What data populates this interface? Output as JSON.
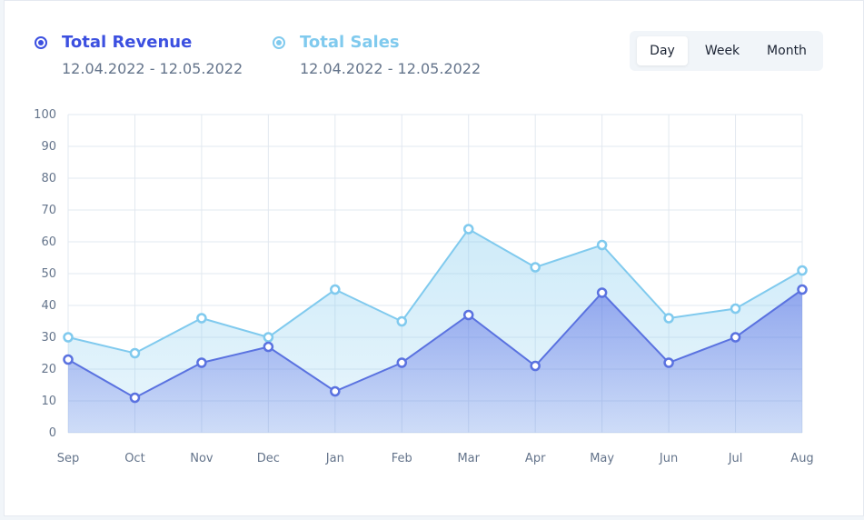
{
  "legend": {
    "revenue": {
      "title": "Total Revenue",
      "range": "12.04.2022 - 12.05.2022"
    },
    "sales": {
      "title": "Total Sales",
      "range": "12.04.2022 - 12.05.2022"
    }
  },
  "period_switcher": {
    "options": [
      "Day",
      "Week",
      "Month"
    ],
    "selected": "Day"
  },
  "colors": {
    "revenue": "#3c50e0",
    "revenue_line": "#5a72e0",
    "sales": "#80caee",
    "grid": "#e2e8f0",
    "text": "#64748b"
  },
  "chart_data": {
    "type": "area",
    "categories": [
      "Sep",
      "Oct",
      "Nov",
      "Dec",
      "Jan",
      "Feb",
      "Mar",
      "Apr",
      "May",
      "Jun",
      "Jul",
      "Aug"
    ],
    "series": [
      {
        "name": "Total Revenue",
        "values": [
          23,
          11,
          22,
          27,
          13,
          22,
          37,
          21,
          44,
          22,
          30,
          45
        ]
      },
      {
        "name": "Total Sales",
        "values": [
          30,
          25,
          36,
          30,
          45,
          35,
          64,
          52,
          59,
          36,
          39,
          51
        ]
      }
    ],
    "yticks": [
      0,
      10,
      20,
      30,
      40,
      50,
      60,
      70,
      80,
      90,
      100
    ],
    "ylim": [
      0,
      100
    ],
    "grid": true,
    "legend_position": "top-left"
  }
}
